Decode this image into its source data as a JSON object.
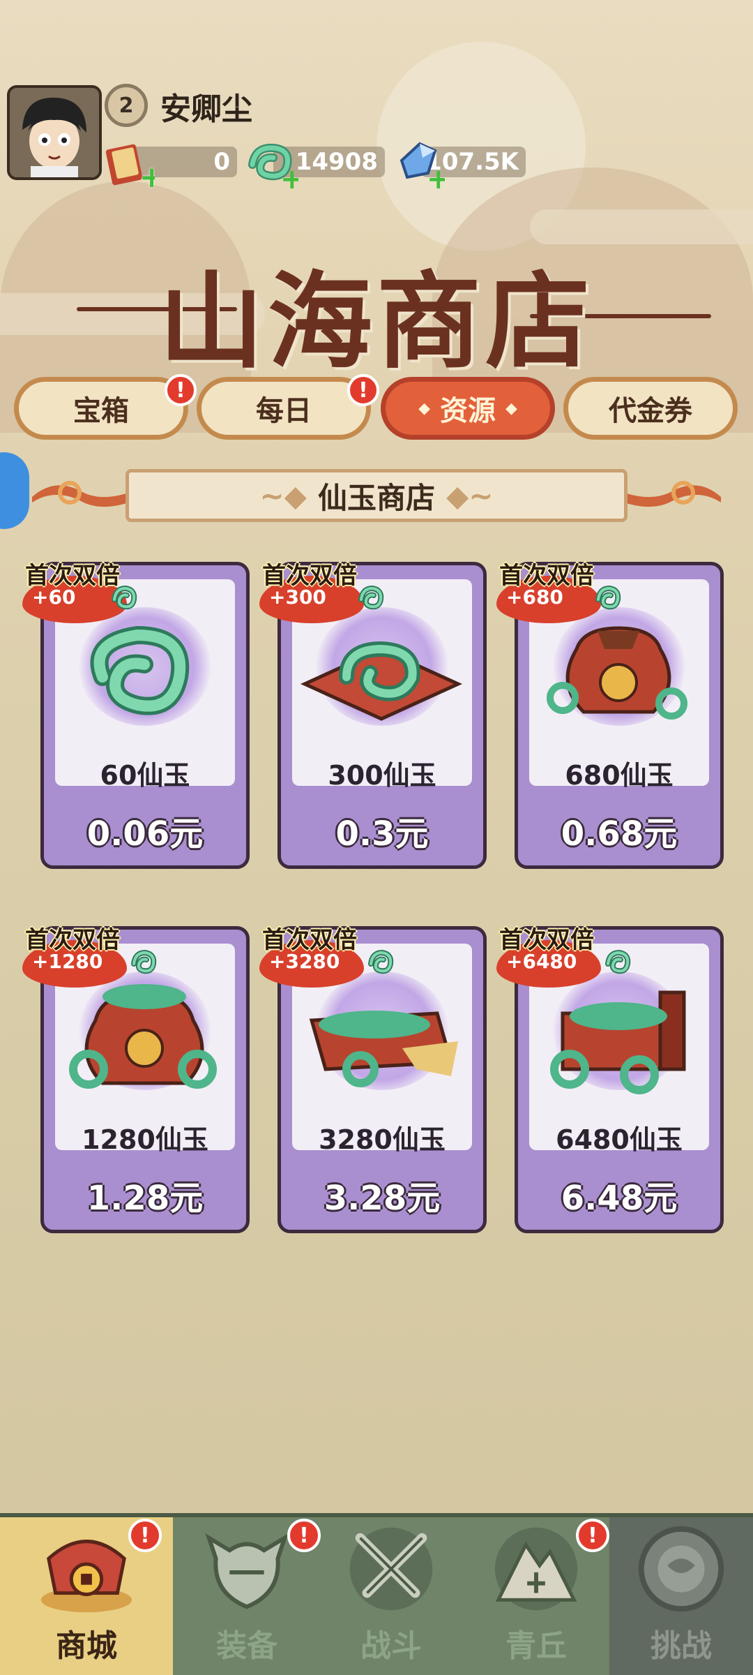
{
  "player": {
    "level": "2",
    "name": "安卿尘"
  },
  "resources": [
    {
      "icon": "scroll-ticket-icon",
      "value": "0"
    },
    {
      "icon": "jade-coin-icon",
      "value": "14908"
    },
    {
      "icon": "crystal-icon",
      "value": "107.5K"
    }
  ],
  "shop_title": "山海商店",
  "tabs": [
    {
      "label": "宝箱",
      "badge": "!"
    },
    {
      "label": "每日",
      "badge": "!"
    },
    {
      "label": "资源",
      "active": true
    },
    {
      "label": "代金券"
    }
  ],
  "section_title": "仙玉商店",
  "promo_label": "首次双倍",
  "products": [
    {
      "bonus": "+60",
      "quantity": "60仙玉",
      "price": "0.06元",
      "image": "jade-coil-icon"
    },
    {
      "bonus": "+300",
      "quantity": "300仙玉",
      "price": "0.3元",
      "image": "jade-on-mat-icon"
    },
    {
      "bonus": "+680",
      "quantity": "680仙玉",
      "price": "0.68元",
      "image": "fortune-bag-icon"
    },
    {
      "bonus": "+1280",
      "quantity": "1280仙玉",
      "price": "1.28元",
      "image": "big-fortune-bag-icon"
    },
    {
      "bonus": "+3280",
      "quantity": "3280仙玉",
      "price": "3.28元",
      "image": "jade-tray-icon"
    },
    {
      "bonus": "+6480",
      "quantity": "6480仙玉",
      "price": "6.48元",
      "image": "jade-chest-icon"
    }
  ],
  "nav": [
    {
      "label": "商城",
      "active": true,
      "badge": "!"
    },
    {
      "label": "装备",
      "badge": "!"
    },
    {
      "label": "战斗"
    },
    {
      "label": "青丘",
      "badge": "!"
    },
    {
      "label": "挑战",
      "locked": true
    }
  ],
  "colors": {
    "card_purple": "#a98fcf",
    "tab_active": "#e2603a",
    "title_brown": "#6b3120",
    "nav_green": "#6f8468",
    "nav_active": "#e9cf84"
  }
}
